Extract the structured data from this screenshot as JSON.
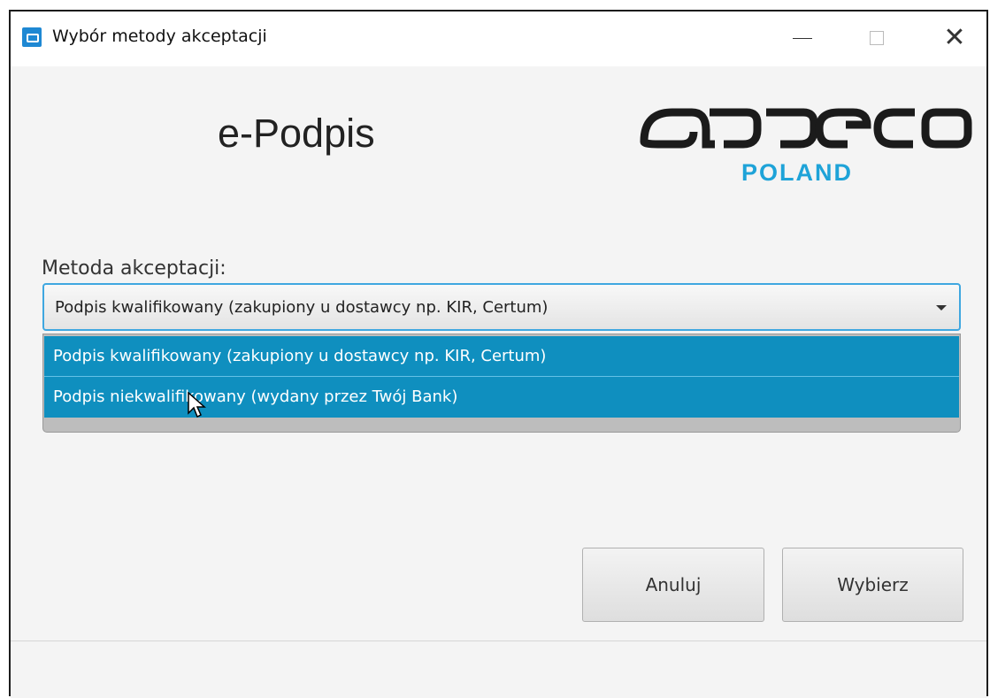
{
  "window": {
    "title": "Wybór metody akceptacji",
    "controls": {
      "minimize_icon": "minimize-icon",
      "maximize_icon": "maximize-icon",
      "close_icon": "close-icon",
      "close_glyph": "✕"
    }
  },
  "header": {
    "title": "e-Podpis",
    "logo_subtitle": "POLAND",
    "logo_icon": "asseco-logo-icon"
  },
  "form": {
    "label": "Metoda akceptacji:",
    "selected_value": "Podpis kwalifikowany (zakupiony u dostawcy np. KIR, Certum)",
    "options": [
      "Podpis kwalifikowany (zakupiony u dostawcy np. KIR, Certum)",
      "Podpis niekwalifikowany (wydany przez Twój Bank)"
    ]
  },
  "buttons": {
    "cancel": "Anuluj",
    "select": "Wybierz"
  },
  "colors": {
    "accent": "#0f8fbf",
    "logo_blue": "#1ea3d8",
    "focus_border": "#3fa7e0"
  }
}
